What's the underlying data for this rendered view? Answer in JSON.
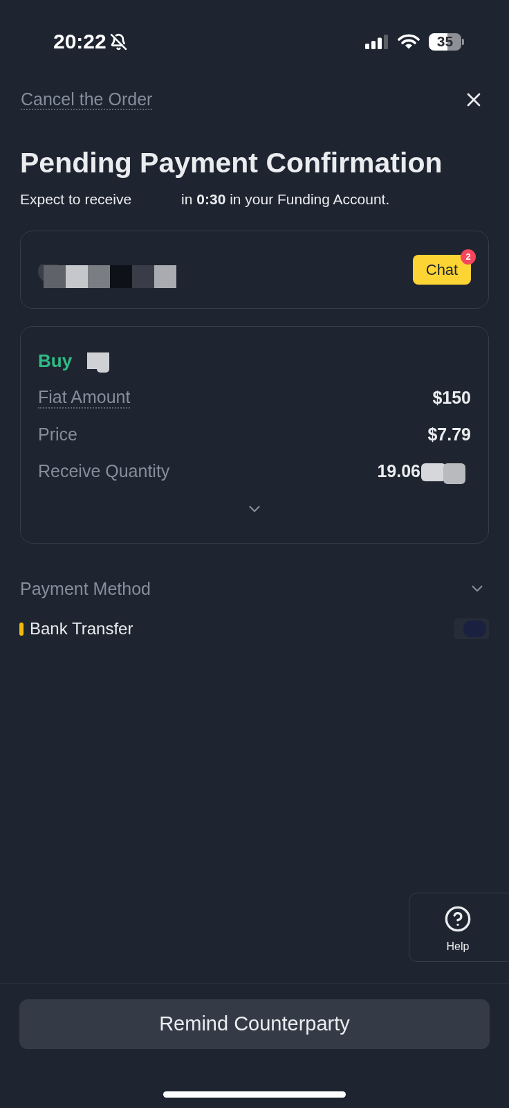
{
  "status_bar": {
    "time": "20:22",
    "battery": "35"
  },
  "header": {
    "cancel_link": "Cancel the Order"
  },
  "title": "Pending Payment Confirmation",
  "subtitle": {
    "before": "Expect to receive",
    "after": "in **0:30** in your Funding Account."
  },
  "counterparty_card": {
    "chat_button": {
      "label": "Chat",
      "badge": "2"
    }
  },
  "order_card": {
    "side": "Buy",
    "expanded": false,
    "rows": [
      {
        "label": "Fiat Amount",
        "value": "$150",
        "kind": "term"
      },
      {
        "label": "Price",
        "value": "$7.79",
        "kind": "plain"
      },
      {
        "label": "Receive Quantity",
        "value": "19.06",
        "kind": "masked"
      }
    ]
  },
  "payment": {
    "title": "Payment Method",
    "expanded": false,
    "methods": [
      {
        "name": "Bank Transfer",
        "color": "#f0b90b"
      }
    ]
  },
  "help": {
    "label": "Help"
  },
  "footer": {
    "button": "Remind Counterparty"
  }
}
